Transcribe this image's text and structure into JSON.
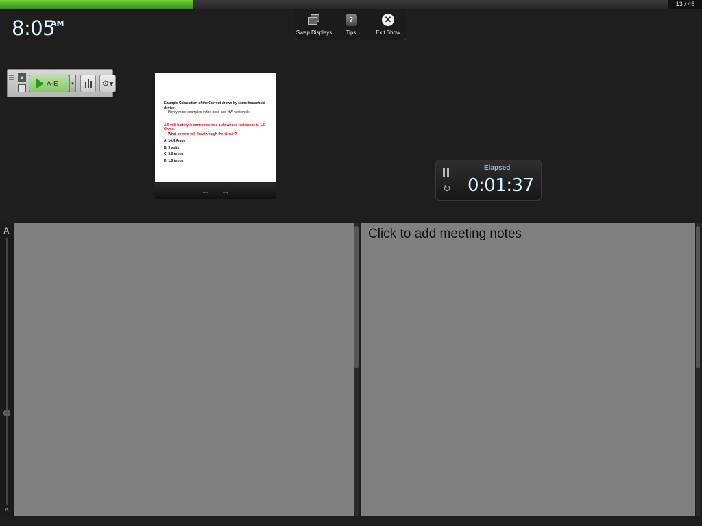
{
  "progress": {
    "fraction": 0.2889,
    "fill_color": "#4caf28",
    "slide_counter": "13 / 45"
  },
  "clock": {
    "time": "8:05",
    "ampm": "AM"
  },
  "toolbar": {
    "swap_displays_label": "Swap Displays",
    "tips_label": "Tips",
    "tips_glyph": "?",
    "exit_show_label": "Exit Show",
    "exit_glyph": "✕"
  },
  "poll_widget": {
    "close_glyph": "x",
    "play_label": "A-E",
    "dropdown_glyph": "▾",
    "settings_glyph": "⚙▾"
  },
  "slide": {
    "title": "Example Calculation of the Current drawn by some household device.",
    "subtitle": "Plenty more examples in the book and HW next week.",
    "question_line1": "A 9 volt battery is connected to a bulb whose resistance is 1.6 Ohms.",
    "question_line2": "What current will flow through the circuit?",
    "options": [
      "A. 14.4 Amps",
      "B. 9 volts",
      "C. 5.6 Amps",
      "D. 1.6 Amps"
    ],
    "prev_glyph": "←",
    "next_glyph": "→"
  },
  "timer": {
    "label": "Elapsed",
    "value": "0:01:37",
    "reset_glyph": "↻"
  },
  "zoom": {
    "large_label": "A",
    "small_label": "A"
  },
  "notes": {
    "placeholder": "Click to add meeting notes"
  },
  "icons": [
    "swap-displays-icon",
    "tips-icon",
    "exit-icon",
    "play-icon",
    "results-chart-icon",
    "gear-icon",
    "pause-icon",
    "reset-icon",
    "arrow-left-icon",
    "arrow-right-icon"
  ]
}
